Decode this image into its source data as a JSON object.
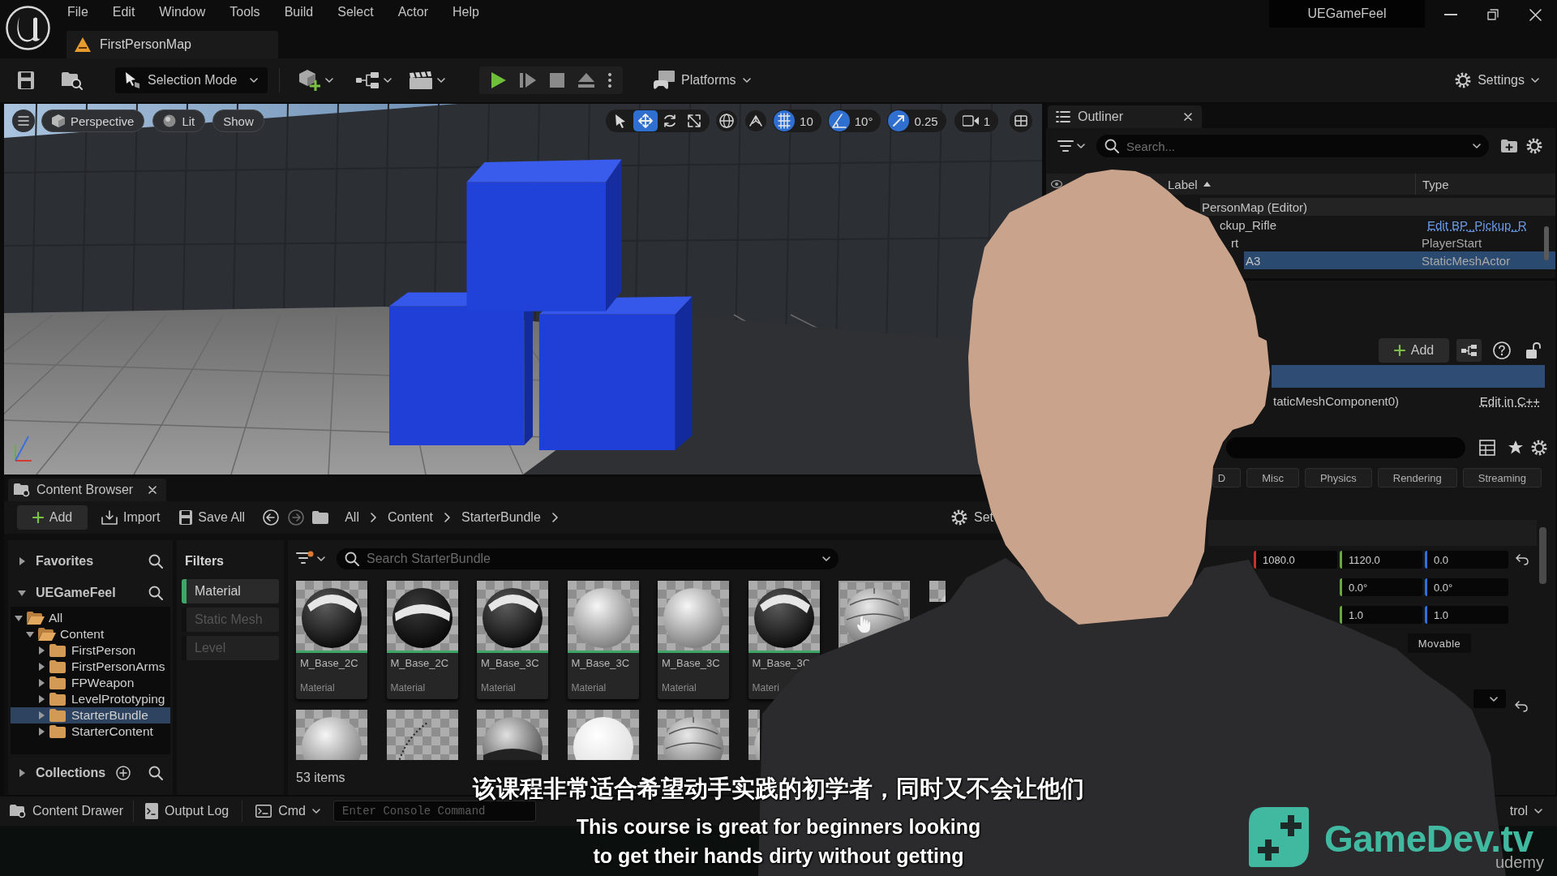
{
  "title_bar": {
    "menus": [
      "File",
      "Edit",
      "Window",
      "Tools",
      "Build",
      "Select",
      "Actor",
      "Help"
    ],
    "map_tab": "FirstPersonMap",
    "project": "UEGameFeel"
  },
  "toolbar": {
    "mode": "Selection Mode",
    "platforms": "Platforms",
    "settings": "Settings"
  },
  "viewport": {
    "view": "Perspective",
    "lighting": "Lit",
    "show": "Show",
    "tools": [
      {
        "kind": "select",
        "selected": false
      },
      {
        "kind": "move",
        "selected": true
      },
      {
        "kind": "rotate",
        "selected": false
      },
      {
        "kind": "scale",
        "selected": false
      }
    ],
    "snaps": [
      {
        "kind": "grid",
        "value": "10",
        "on": true
      },
      {
        "kind": "angle",
        "value": "10°",
        "on": true
      },
      {
        "kind": "scale",
        "value": "0.25",
        "on": true
      }
    ],
    "camera_speed": "1"
  },
  "outliner": {
    "title": "Outliner",
    "search": {
      "placeholder": "Search..."
    },
    "columns": [
      {
        "label": "Label",
        "sorted": true
      },
      {
        "label": "Type",
        "sorted": false
      }
    ],
    "rows": [
      {
        "kind": "level",
        "label": "PersonMap (Editor)",
        "selected": false
      },
      {
        "kind": "actor",
        "label": "ckup_Rifle",
        "type": "Edit BP_Pickup_R",
        "type_link": true,
        "selected": false
      },
      {
        "kind": "actor",
        "label": "rt",
        "type": "PlayerStart",
        "type_link": false,
        "selected": false
      },
      {
        "kind": "actor",
        "label": "A3",
        "type": "StaticMeshActor",
        "type_link": false,
        "selected": true
      }
    ]
  },
  "details": {
    "add": "Add",
    "components": [
      {
        "selected": true
      },
      {
        "label": "taticMeshComponent0)",
        "link": "Edit in C++",
        "selected": false
      }
    ],
    "categories": [
      "D",
      "Misc",
      "Physics",
      "Rendering",
      "Streaming"
    ],
    "transform": [
      {
        "fields": [
          {
            "value": "1080.0",
            "color": "#c8302c"
          },
          {
            "value": "1120.0",
            "color": "#6aa83c"
          },
          {
            "value": "0.0",
            "color": "#2f6fe0"
          }
        ],
        "reset": true
      },
      {
        "fields": [
          {
            "value": "0.0°",
            "color": "#6aa83c"
          },
          {
            "value": "0.0°",
            "color": "#2f6fe0"
          }
        ],
        "reset": false
      },
      {
        "fields": [
          {
            "value": "1.0",
            "color": "#6aa83c"
          },
          {
            "value": "1.0",
            "color": "#2f6fe0"
          }
        ],
        "reset": false
      }
    ],
    "mobility": "Movable",
    "dropdown": {
      "reset": true
    }
  },
  "content_browser": {
    "tab": "Content Browser",
    "toolbar": {
      "add": "Add",
      "import": "Import",
      "save_all": "Save All",
      "path": [
        "All",
        "Content",
        "StarterBundle"
      ],
      "settings": "Set"
    },
    "favorites": {
      "label": "Favorites",
      "expanded": false
    },
    "project": {
      "label": "UEGameFeel",
      "expanded": true
    },
    "tree": [
      {
        "label": "All",
        "expanded": true,
        "selected": false,
        "children": [
          {
            "label": "Content",
            "expanded": true,
            "selected": false,
            "children": [
              {
                "label": "FirstPerson",
                "expanded": false,
                "selected": false
              },
              {
                "label": "FirstPersonArms",
                "expanded": false,
                "selected": false
              },
              {
                "label": "FPWeapon",
                "expanded": false,
                "selected": false
              },
              {
                "label": "LevelPrototyping",
                "expanded": false,
                "selected": false
              },
              {
                "label": "StarterBundle",
                "expanded": false,
                "selected": true
              },
              {
                "label": "StarterContent",
                "expanded": false,
                "selected": false
              }
            ]
          }
        ]
      }
    ],
    "collections": {
      "label": "Collections",
      "expanded": false
    },
    "filters": {
      "title": "Filters",
      "items": [
        {
          "label": "Material",
          "on": true
        },
        {
          "label": "Static Mesh",
          "on": false
        },
        {
          "label": "Level",
          "on": false
        }
      ]
    },
    "search": {
      "placeholder": "Search StarterBundle"
    },
    "asset_rows": [
      [
        {
          "name": "M_Base_2C",
          "type": "Material",
          "hovered": false
        },
        {
          "name": "M_Base_2C",
          "type": "Material",
          "hovered": false
        },
        {
          "name": "M_Base_3C",
          "type": "Material",
          "hovered": false
        },
        {
          "name": "M_Base_3C",
          "type": "Material",
          "hovered": false
        },
        {
          "name": "M_Base_3C",
          "type": "Material",
          "hovered": false
        },
        {
          "name": "M_Base_3C",
          "type": "Materi",
          "hovered": false
        },
        {
          "hovered": true
        },
        {
          "hovered": false
        }
      ],
      [
        {
          "hovered": false
        },
        {
          "hovered": false
        },
        {
          "hovered": false
        },
        {
          "hovered": false
        },
        {
          "hovered": false
        },
        {
          "hovered": false
        }
      ]
    ],
    "count": "53 items"
  },
  "status_bar": {
    "content_drawer": "Content Drawer",
    "output_log": "Output Log",
    "cmd": "Cmd",
    "console": {
      "placeholder": "Enter Console Command"
    },
    "right": "trol"
  },
  "subtitles": [
    "该课程非常适合希望动手实践的初学者，同时又不会让他们",
    "This course is great for beginners looking",
    "to get their hands dirty without getting"
  ],
  "brand": {
    "name": "GameDev.tv",
    "platform": "udemy"
  }
}
